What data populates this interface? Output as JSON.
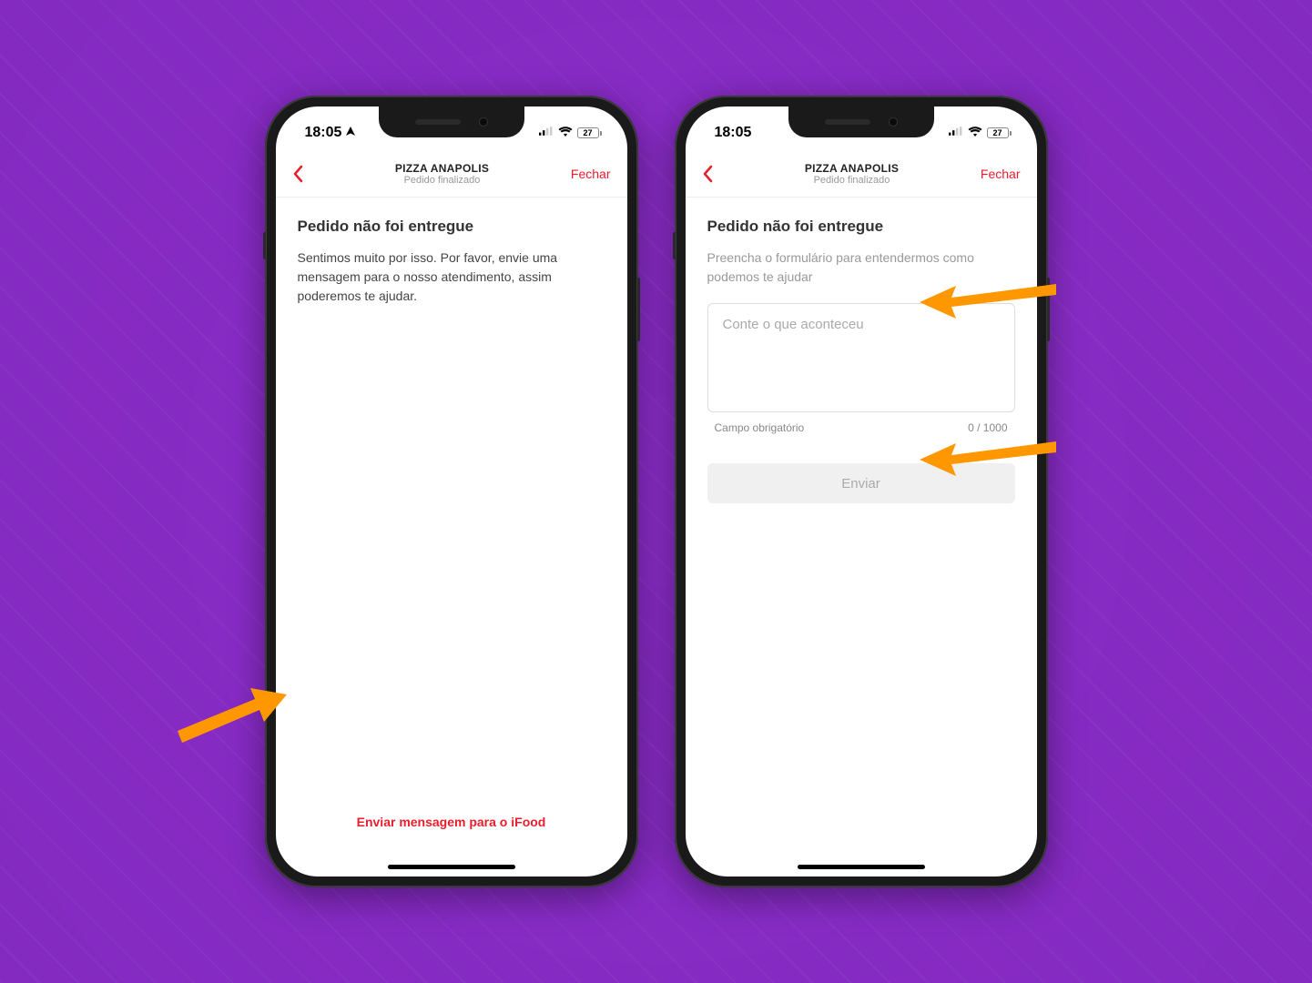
{
  "status_bar": {
    "time": "18:05",
    "battery": "27"
  },
  "nav": {
    "title": "PIZZA ANAPOLIS",
    "subtitle": "Pedido finalizado",
    "close": "Fechar"
  },
  "left_screen": {
    "heading": "Pedido não foi entregue",
    "body": "Sentimos muito por isso. Por favor, envie uma mensagem para o nosso atendimento, assim poderemos te ajudar.",
    "footer_action": "Enviar mensagem para o iFood"
  },
  "right_screen": {
    "heading": "Pedido não foi entregue",
    "help": "Preencha o formulário para entendermos como podemos te ajudar",
    "placeholder": "Conte o que aconteceu",
    "required_label": "Campo obrigatório",
    "counter": "0 / 1000",
    "submit": "Enviar"
  }
}
